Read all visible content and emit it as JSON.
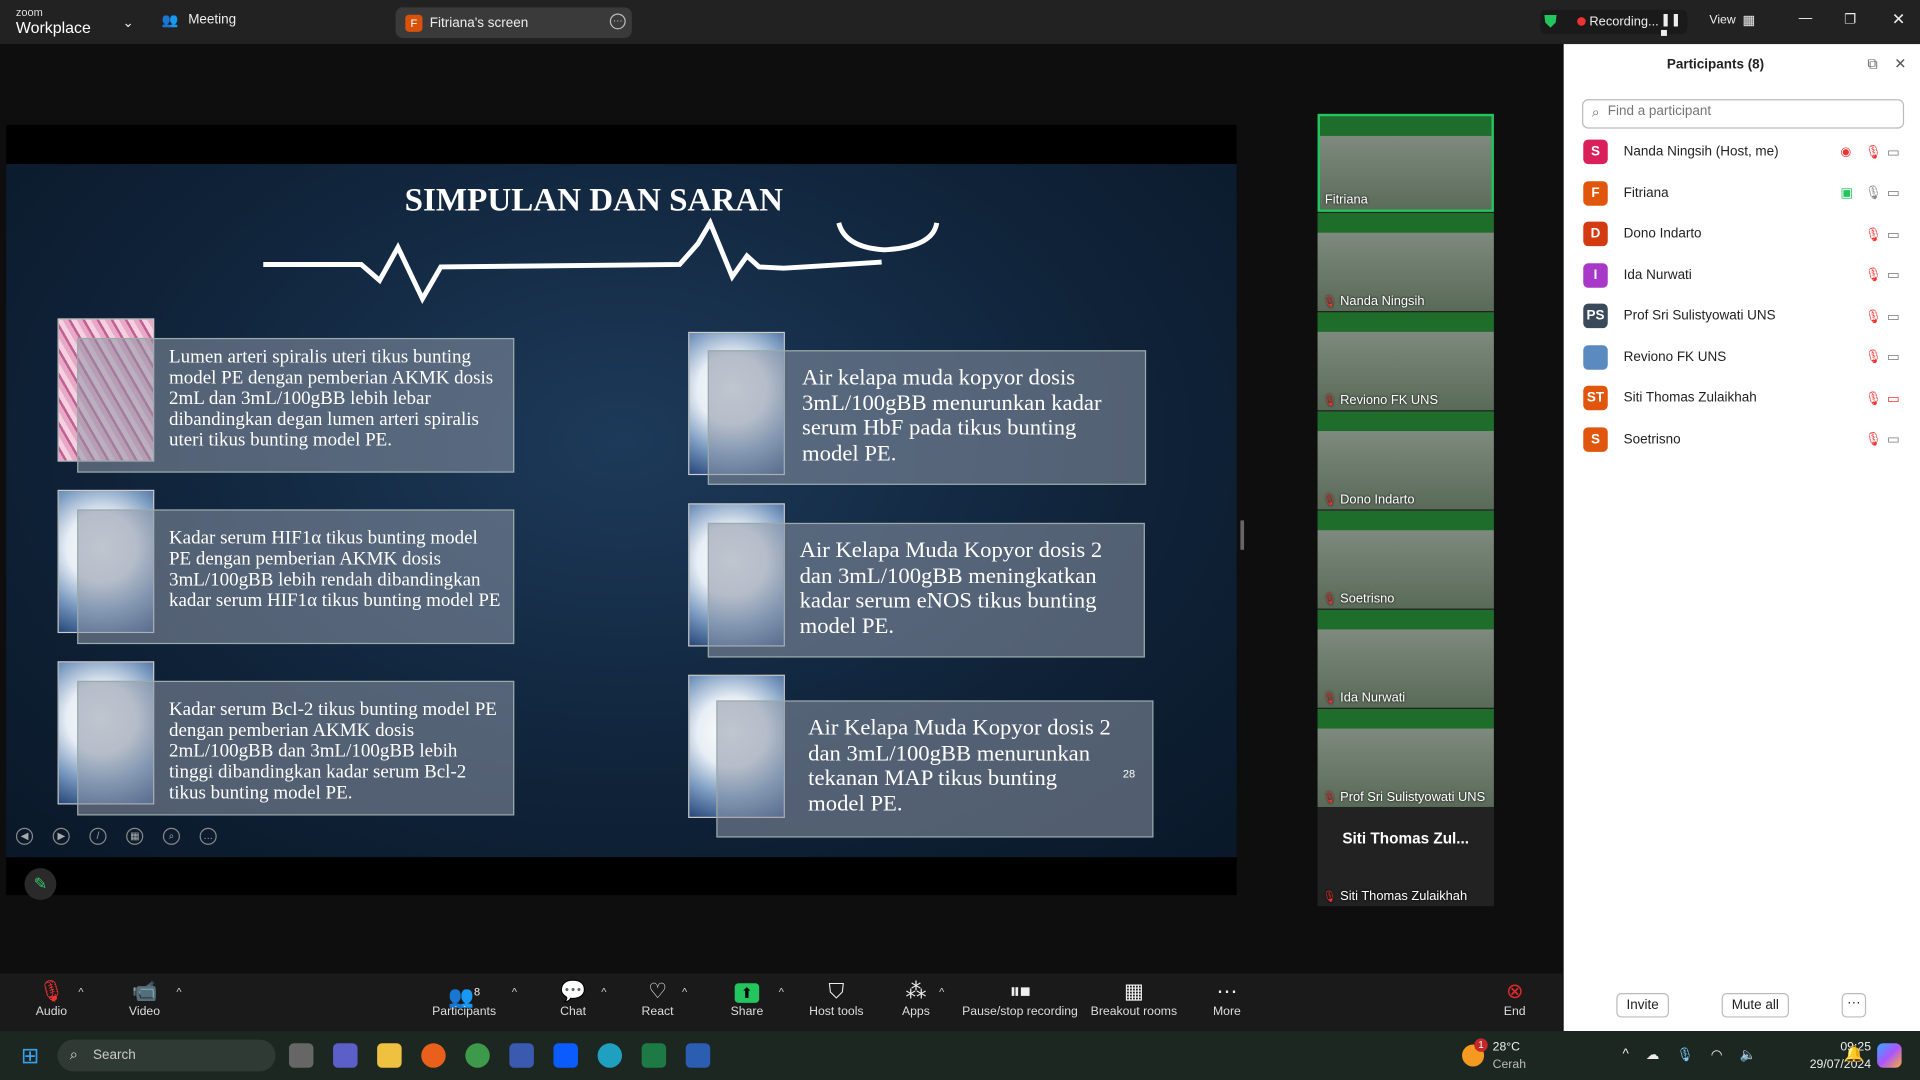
{
  "app": {
    "brand_small": "zoom",
    "brand": "Workplace",
    "meeting_label": "Meeting",
    "share_avatar": "F",
    "share_label": "Fitriana's screen",
    "recording": "Recording...",
    "view": "View"
  },
  "slide": {
    "title": "SIMPULAN DAN SARAN",
    "page": "28",
    "left": [
      "Lumen arteri spiralis uteri tikus bunting model PE  dengan pemberian AKMK dosis 2mL dan 3mL/100gBB lebih lebar dibandingkan degan  lumen arteri spiralis uteri tikus bunting model PE.",
      "Kadar serum HIF1α  tikus bunting model PE dengan pemberian AKMK dosis 3mL/100gBB lebih rendah dibandingkan kadar serum HIF1α tikus bunting model PE",
      "Kadar serum Bcl-2 tikus bunting model PE dengan pemberian AKMK dosis 2mL/100gBB dan 3mL/100gBB lebih tinggi dibandingkan kadar serum Bcl-2  tikus bunting model PE."
    ],
    "right": [
      "Air kelapa muda kopyor  dosis 3mL/100gBB menurunkan kadar serum HbF  pada tikus bunting model PE.",
      "Air Kelapa Muda Kopyor dosis 2 dan 3mL/100gBB meningkatkan kadar serum eNOS  tikus bunting model PE.",
      "Air Kelapa Muda Kopyor dosis 2 dan 3mL/100gBB menurunkan tekanan MAP tikus bunting model PE."
    ]
  },
  "gallery": [
    {
      "name": "Fitriana"
    },
    {
      "name": "Nanda Ningsih"
    },
    {
      "name": "Reviono FK UNS"
    },
    {
      "name": "Dono Indarto"
    },
    {
      "name": "Soetrisno"
    },
    {
      "name": "Ida Nurwati"
    },
    {
      "name": "Prof Sri  Sulistyowati UNS"
    },
    {
      "name": "Siti Thomas Zulaikhah",
      "big": "Siti Thomas Zul..."
    }
  ],
  "participants": {
    "title": "Participants (8)",
    "search_placeholder": "Find a participant",
    "invite": "Invite",
    "mute_all": "Mute all",
    "list": [
      {
        "initials": "S",
        "name": "Nanda Ningsih (Host, me)",
        "color": "#d9205a"
      },
      {
        "initials": "F",
        "name": "Fitriana",
        "color": "#e0560c"
      },
      {
        "initials": "D",
        "name": "Dono Indarto",
        "color": "#d43a10"
      },
      {
        "initials": "I",
        "name": "Ida Nurwati",
        "color": "#a838c8"
      },
      {
        "initials": "PS",
        "name": "Prof Sri  Sulistyowati UNS",
        "color": "#3a4a5a"
      },
      {
        "initials": "",
        "name": "Reviono FK UNS",
        "color": "#5a8ac0"
      },
      {
        "initials": "ST",
        "name": "Siti Thomas Zulaikhah",
        "color": "#e0560c"
      },
      {
        "initials": "S",
        "name": "Soetrisno",
        "color": "#e0560c"
      }
    ]
  },
  "toolbar": {
    "audio": "Audio",
    "video": "Video",
    "participants": "Participants",
    "participants_count": "8",
    "chat": "Chat",
    "react": "React",
    "share": "Share",
    "host_tools": "Host tools",
    "apps": "Apps",
    "pause_rec": "Pause/stop recording",
    "breakout": "Breakout rooms",
    "more": "More",
    "end": "End"
  },
  "taskbar": {
    "search": "Search",
    "weather_temp": "28°C",
    "weather_desc": "Cerah",
    "weather_badge": "1",
    "time": "09:25",
    "date": "29/07/2024"
  },
  "colors": {
    "accent_green": "#22c55e",
    "end_red": "#e02828",
    "zoom_blue": "#0b5cff"
  }
}
